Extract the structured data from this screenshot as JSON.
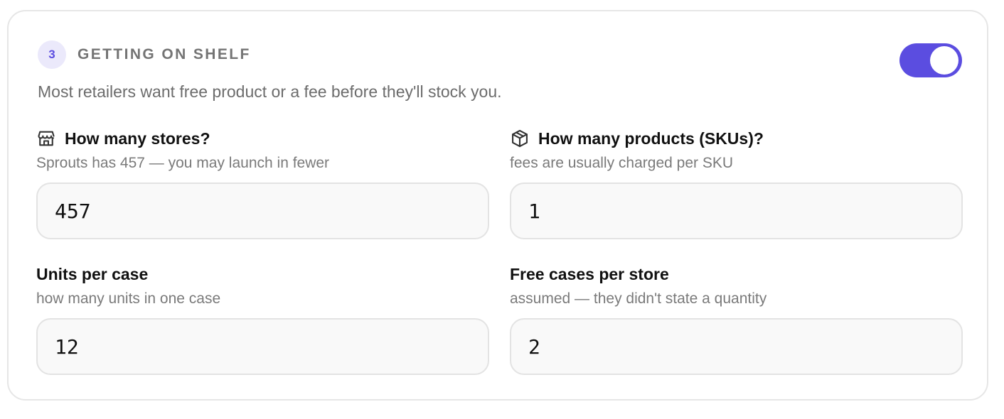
{
  "section": {
    "step_number": "3",
    "title": "GETTING ON SHELF",
    "description": "Most retailers want free product or a fee before they'll stock you.",
    "toggle_on": true,
    "accent_color": "#5b4de0"
  },
  "fields": {
    "stores": {
      "icon": "store-icon",
      "label": "How many stores?",
      "hint": "Sprouts has 457 — you may launch in fewer",
      "value": "457"
    },
    "skus": {
      "icon": "box-icon",
      "label": "How many products (SKUs)?",
      "hint": "fees are usually charged per SKU",
      "value": "1"
    },
    "units_per_case": {
      "label": "Units per case",
      "hint": "how many units in one case",
      "value": "12"
    },
    "free_cases": {
      "label": "Free cases per store",
      "hint": "assumed — they didn't state a quantity",
      "value": "2"
    }
  }
}
